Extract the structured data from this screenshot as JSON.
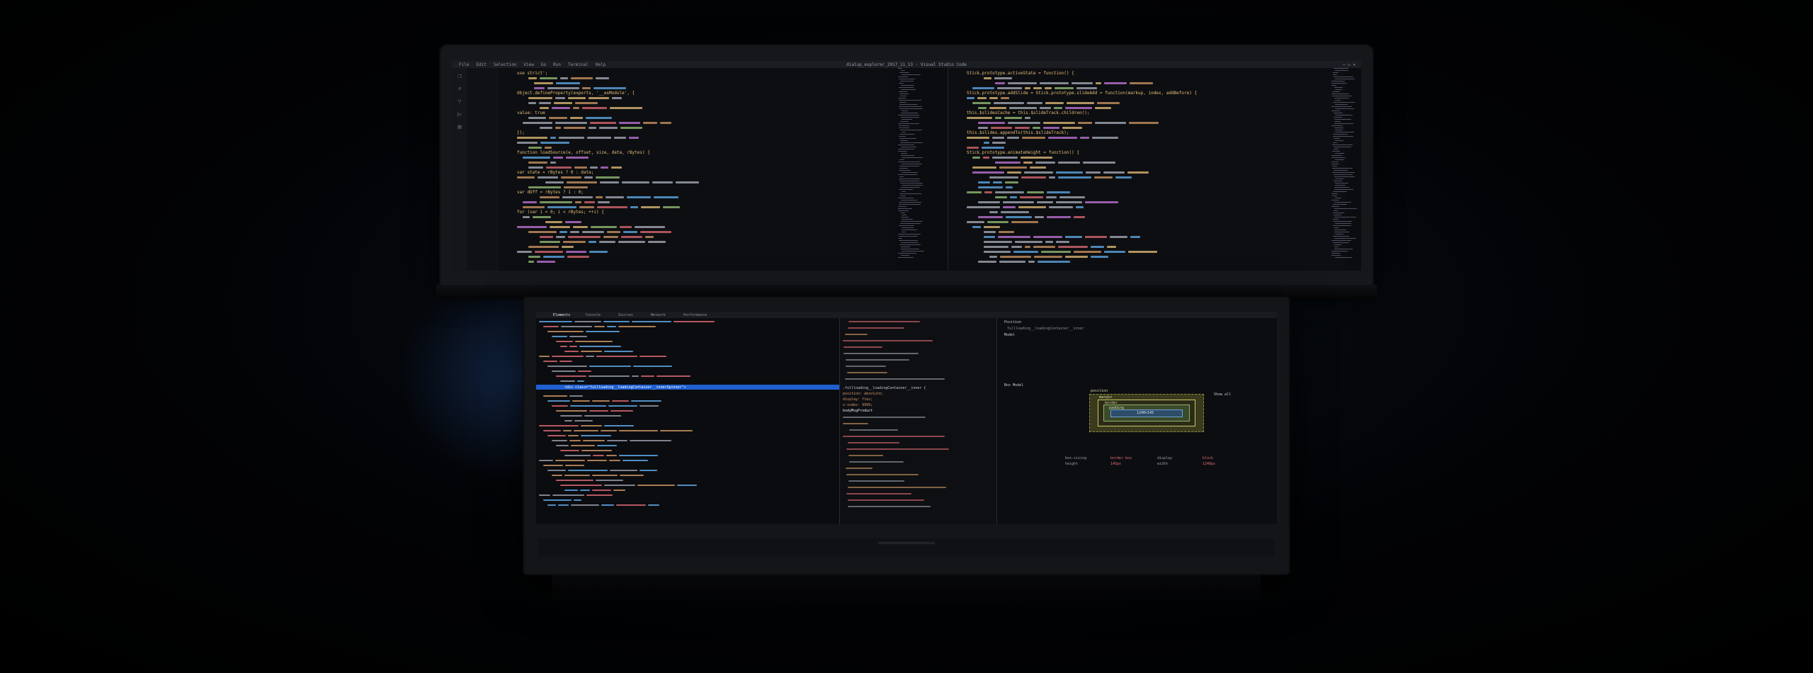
{
  "top_screen": {
    "window_title": "dialup_explorer_2017_11_13 · Visual Studio Code",
    "menu": [
      "File",
      "Edit",
      "Selection",
      "View",
      "Go",
      "Run",
      "Terminal",
      "Help"
    ],
    "code_lines_left": [
      "use strict';",
      "Object.defineProperty(exports, '__esModule', {",
      "  value: true",
      "});",
      "function loadSource(e, offset, size, data, rBytes) {",
      "  var state = rBytes ? 0 : data;",
      "  var dOff = rBytes ? 1 : 0;",
      "  for (var i = 0; i < rBytes; ++i) {"
    ],
    "code_lines_right": [
      "Stick.prototype.activeState = function() {",
      "Stick.prototype.addSlide = Stick.prototype.slideAdd = function(markup, index, addBefore) {",
      "  this.$slidesCache = this.$slideTrack.children();",
      "  this.$slides.appendTo(this.$slideTrack);",
      "Stick.prototype.animateHeight = function() {"
    ]
  },
  "devtools": {
    "tabs": [
      "Elements",
      "Console",
      "Sources",
      "Network",
      "Performance"
    ],
    "selected_node": "<div class=\"fullloading__loadingContainer__innerSpinner\">",
    "styles_rules": [
      ".fullloading__loadingContainer__inner {",
      "  position: absolute;",
      "  display: flex;",
      "  z-index: 9999;",
      "  bodyMsgProduct"
    ],
    "layout_sections": [
      "Position",
      "Model",
      "Box Model"
    ],
    "position_value": "fullloading__loadingContainer__inner",
    "box_model_labels": [
      "position",
      "margin",
      "border",
      "padding",
      "content"
    ],
    "box_model_content": "1240×145",
    "computed_props": [
      {
        "name": "box-sizing",
        "value": "border-box"
      },
      {
        "name": "display",
        "value": "block"
      },
      {
        "name": "height",
        "value": "145px"
      },
      {
        "name": "width",
        "value": "1240px"
      }
    ],
    "show_all": "Show all"
  },
  "palette": {
    "background": "#000000",
    "selection_blue": "#1f5fd1",
    "keyword_purple": "#c678dd",
    "string_orange": "#d19a66",
    "function_yellow": "#e5c07b",
    "identifier_blue": "#61afef",
    "comment_green": "#98c379",
    "tag_red": "#e06c75"
  }
}
